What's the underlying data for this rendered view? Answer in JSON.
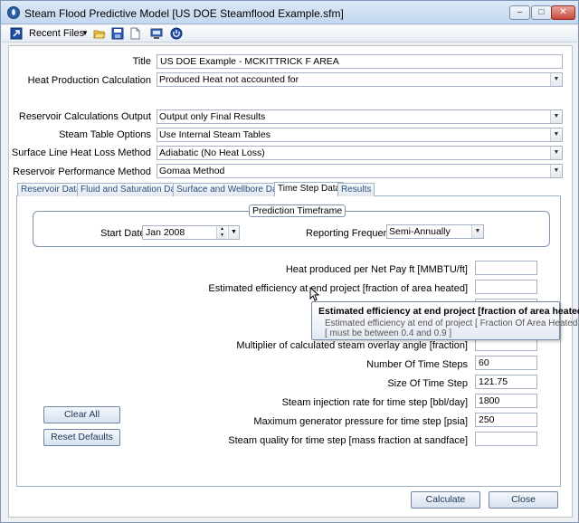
{
  "window": {
    "title": "Steam Flood Predictive Model [US DOE Steamflood Example.sfm]",
    "controls": {
      "minimize": "–",
      "maximize": "□",
      "close": "✕"
    }
  },
  "toolbar": {
    "recent_files": "Recent Files",
    "icons": [
      "recent-files-icon",
      "open-folder-icon",
      "save-icon",
      "new-document-icon",
      "print-preview-icon",
      "power-icon"
    ]
  },
  "form": {
    "title_label": "Title",
    "title_value": "US DOE Example - MCKITTRICK F AREA",
    "heat_prod_label": "Heat Production Calculation",
    "heat_prod_value": "Produced Heat not accounted for",
    "res_calc_label": "Reservoir Calculations Output",
    "res_calc_value": "Output only Final Results",
    "steam_table_label": "Steam Table Options",
    "steam_table_value": "Use Internal Steam Tables",
    "surface_loss_label": "Surface Line Heat Loss Method",
    "surface_loss_value": "Adiabatic (No Heat Loss)",
    "res_perf_label": "Reservoir Performance Method",
    "res_perf_value": "Gomaa Method"
  },
  "tabs": [
    {
      "label": "Reservoir Data"
    },
    {
      "label": "Fluid and Saturation Data"
    },
    {
      "label": "Surface and Wellbore Data"
    },
    {
      "label": "Time Step Data"
    },
    {
      "label": "Results"
    }
  ],
  "prediction": {
    "group_title": "Prediction Timeframe",
    "start_date_label": "Start Date",
    "start_date_value": "Jan 2008",
    "freq_label": "Reporting Frequency",
    "freq_value": "Semi-Annually"
  },
  "fields": {
    "heat_per_pay_label": "Heat produced per Net Pay ft [MMBTU/ft]",
    "heat_per_pay_value": "",
    "efficiency_label": "Estimated efficiency at end project [fraction of area heated]",
    "efficiency_value": "",
    "overlay_label": "Multiplier of calculated steam overlay angle [fraction]",
    "overlay_value": "",
    "num_steps_label": "Number Of Time Steps",
    "num_steps_value": "60",
    "step_size_label": "Size Of Time Step",
    "step_size_value": "121.75",
    "injection_label": "Steam injection rate for time step [bbl/day]",
    "injection_value": "1800",
    "pressure_label": "Maximum generator pressure for time step [psia]",
    "pressure_value": "250",
    "quality_label": "Steam quality for time step [mass fraction at sandface]",
    "quality_value": ""
  },
  "tooltip": {
    "title": "Estimated efficiency at end project [fraction of area heated]",
    "line1": "Estimated efficiency at end of project [ Fraction Of Area Heated ]",
    "line2": "[ must be between 0.4 and 0.9 ]"
  },
  "buttons": {
    "clear_all": "Clear All",
    "reset_defaults": "Reset Defaults",
    "calculate": "Calculate",
    "close": "Close"
  }
}
